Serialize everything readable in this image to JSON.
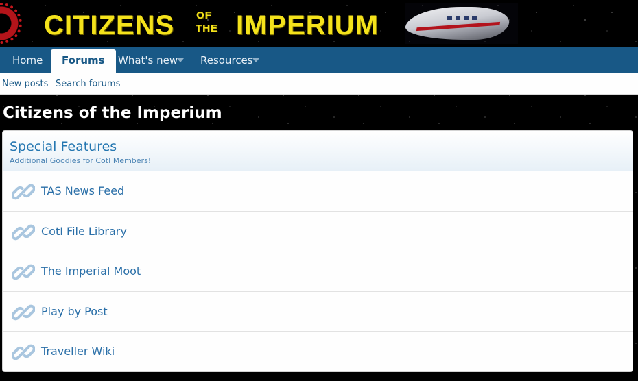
{
  "banner": {
    "word_citizens": "CITIZENS",
    "word_of": "OF",
    "word_the": "THE",
    "word_imperium": "IMPERIUM",
    "logo_color": "#f4e21b",
    "accent_red": "#b4141a"
  },
  "nav": {
    "tabs": [
      {
        "label": "Home",
        "active": false,
        "has_menu": false
      },
      {
        "label": "Forums",
        "active": true,
        "has_menu": false
      },
      {
        "label": "What's new",
        "active": false,
        "has_menu": true
      },
      {
        "label": "Resources",
        "active": false,
        "has_menu": true
      }
    ],
    "background_color": "#185886",
    "caret_icon": "caret-down-icon"
  },
  "subnav": {
    "links": [
      {
        "label": "New posts"
      },
      {
        "label": "Search forums"
      }
    ]
  },
  "page": {
    "title": "Citizens of the Imperium"
  },
  "category": {
    "title": "Special Features",
    "description": "Additional Goodies for CotI Members!",
    "accent_color": "#2577b1",
    "link_icon": "link-icon",
    "nodes": [
      {
        "title": "TAS News Feed"
      },
      {
        "title": "CotI File Library"
      },
      {
        "title": "The Imperial Moot"
      },
      {
        "title": "Play by Post"
      },
      {
        "title": "Traveller Wiki"
      }
    ]
  }
}
